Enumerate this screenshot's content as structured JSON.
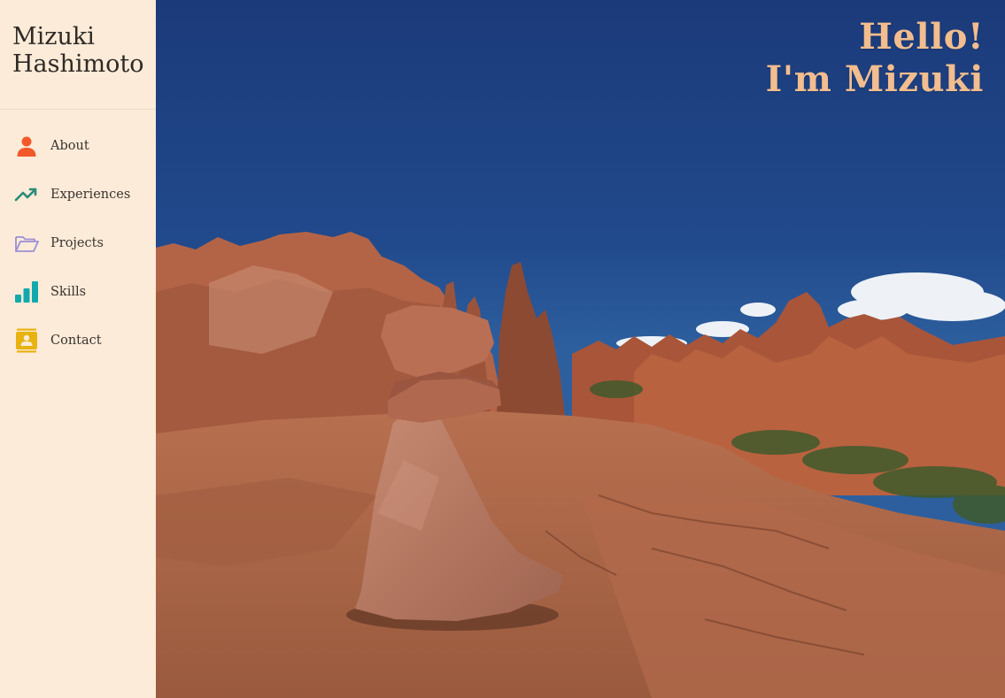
{
  "sidebar": {
    "name_line1": "Mizuki",
    "name_line2": "Hashimoto",
    "items": [
      {
        "label": "About",
        "icon": "person-icon",
        "color": "#f2592a"
      },
      {
        "label": "Experiences",
        "icon": "trending-up-icon",
        "color": "#2a8a78"
      },
      {
        "label": "Projects",
        "icon": "folder-open-icon",
        "color": "#9d8fd6"
      },
      {
        "label": "Skills",
        "icon": "bar-chart-icon",
        "color": "#12a9ad"
      },
      {
        "label": "Contact",
        "icon": "contact-card-icon",
        "color": "#e8b311"
      }
    ]
  },
  "hero": {
    "greeting": "Hello!",
    "intro": "I'm Mizuki"
  },
  "colors": {
    "sidebar_bg": "#fbebd8",
    "hero_text": "#f2bd8f",
    "sky_top": "#1b3a7a"
  }
}
